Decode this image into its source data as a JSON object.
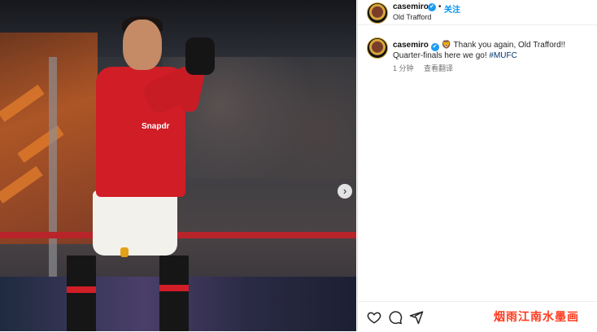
{
  "post": {
    "author": "casemiro",
    "follow_label": "关注",
    "location": "Old Trafford",
    "caption_prefix": "🦁 Thank you again, Old Trafford!! Quarter-finals here we go! ",
    "hashtag": "#MUFC",
    "time_ago": "1 分钟",
    "translate_label": "查看翻译",
    "verified_glyph": "✔",
    "dot": "•"
  },
  "photo": {
    "jersey_sponsor": "Snapdr",
    "next_glyph": "›"
  },
  "actions": {
    "like_icon": "heart-icon",
    "comment_icon": "comment-icon",
    "share_icon": "share-icon"
  },
  "watermark": "烟雨江南水墨画",
  "colors": {
    "accent": "#0095f6",
    "verified": "#1d9bf0",
    "watermark": "#ff3b1f",
    "kit_red": "#d01d26"
  }
}
